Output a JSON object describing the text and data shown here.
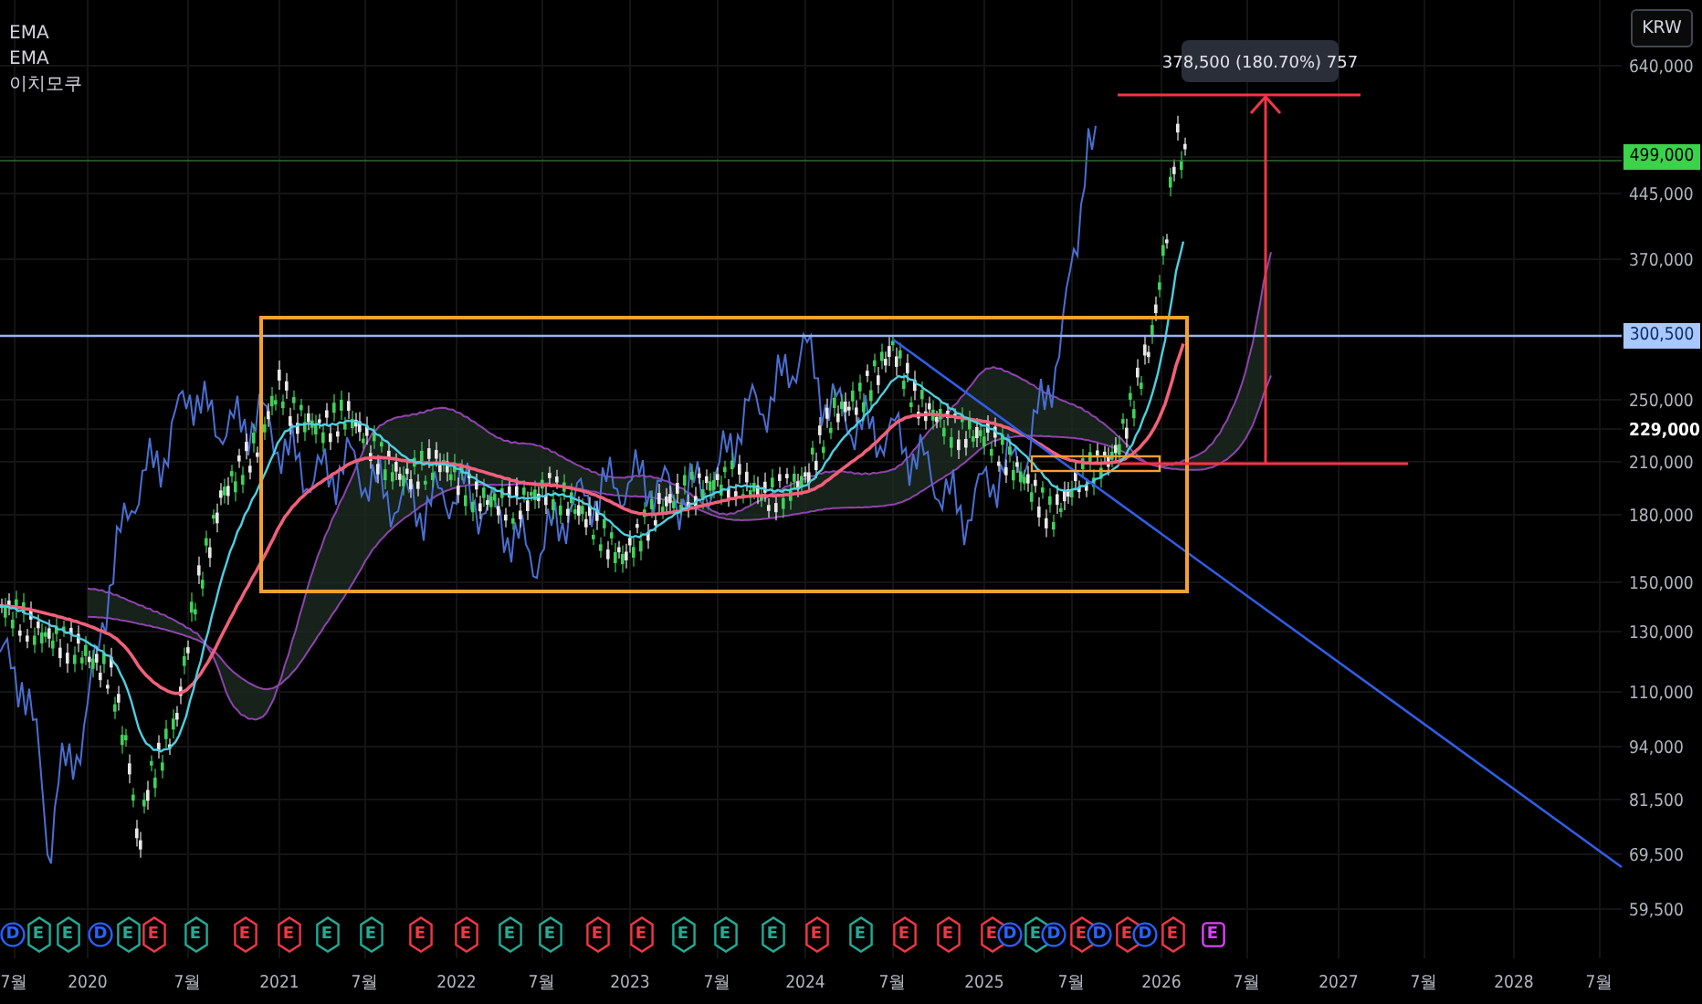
{
  "legend": [
    {
      "label": "EMA"
    },
    {
      "label": "EMA"
    },
    {
      "label": "이치모쿠"
    }
  ],
  "currency_button": {
    "label": "KRW"
  },
  "measure_label": "378,500 (180.70%) 757",
  "price_axis": [
    {
      "label": "640,000",
      "kind": "tick"
    },
    {
      "label": "499,000",
      "kind": "last_price"
    },
    {
      "label": "445,000",
      "kind": "tick"
    },
    {
      "label": "370,000",
      "kind": "tick"
    },
    {
      "label": "300,500",
      "kind": "line_price"
    },
    {
      "label": "250,000",
      "kind": "tick"
    },
    {
      "label": "229,000",
      "kind": "highlight"
    },
    {
      "label": "210,000",
      "kind": "tick"
    },
    {
      "label": "180,000",
      "kind": "tick"
    },
    {
      "label": "150,000",
      "kind": "tick"
    },
    {
      "label": "130,000",
      "kind": "tick"
    },
    {
      "label": "110,000",
      "kind": "tick"
    },
    {
      "label": "94,000",
      "kind": "tick"
    },
    {
      "label": "81,500",
      "kind": "tick"
    },
    {
      "label": "69,500",
      "kind": "tick"
    },
    {
      "label": "59,500",
      "kind": "tick"
    }
  ],
  "time_axis": [
    "7월",
    "2020",
    "7월",
    "2021",
    "7월",
    "2022",
    "7월",
    "2023",
    "7월",
    "2024",
    "7월",
    "2025",
    "7월",
    "2026",
    "7월",
    "2027",
    "7월",
    "2028",
    "7월"
  ],
  "events": [
    {
      "letter": "D",
      "kind": "dividend",
      "color": "#2962ff"
    },
    {
      "letter": "E",
      "kind": "earnings",
      "color": "#22ab94"
    },
    {
      "letter": "E",
      "kind": "earnings",
      "color": "#22ab94"
    },
    {
      "letter": "D",
      "kind": "dividend",
      "color": "#2962ff"
    },
    {
      "letter": "E",
      "kind": "earnings",
      "color": "#22ab94"
    },
    {
      "letter": "E",
      "kind": "earnings",
      "color": "#f23645"
    },
    {
      "letter": "E",
      "kind": "earnings",
      "color": "#22ab94"
    },
    {
      "letter": "E",
      "kind": "earnings",
      "color": "#f23645"
    },
    {
      "letter": "E",
      "kind": "earnings",
      "color": "#f23645"
    },
    {
      "letter": "E",
      "kind": "earnings",
      "color": "#22ab94"
    },
    {
      "letter": "E",
      "kind": "earnings",
      "color": "#22ab94"
    },
    {
      "letter": "E",
      "kind": "earnings",
      "color": "#f23645"
    },
    {
      "letter": "E",
      "kind": "earnings",
      "color": "#f23645"
    },
    {
      "letter": "E",
      "kind": "earnings",
      "color": "#22ab94"
    },
    {
      "letter": "E",
      "kind": "earnings",
      "color": "#22ab94"
    },
    {
      "letter": "E",
      "kind": "earnings",
      "color": "#f23645"
    },
    {
      "letter": "E",
      "kind": "earnings",
      "color": "#f23645"
    },
    {
      "letter": "E",
      "kind": "earnings",
      "color": "#22ab94"
    },
    {
      "letter": "E",
      "kind": "earnings",
      "color": "#22ab94"
    },
    {
      "letter": "E",
      "kind": "earnings",
      "color": "#22ab94"
    },
    {
      "letter": "E",
      "kind": "earnings",
      "color": "#f23645"
    },
    {
      "letter": "E",
      "kind": "earnings",
      "color": "#22ab94"
    },
    {
      "letter": "E",
      "kind": "earnings",
      "color": "#f23645"
    },
    {
      "letter": "E",
      "kind": "earnings",
      "color": "#f23645"
    },
    {
      "letter": "E",
      "kind": "earnings",
      "color": "#f23645"
    },
    {
      "letter": "D",
      "kind": "dividend",
      "color": "#2962ff"
    },
    {
      "letter": "E",
      "kind": "earnings",
      "color": "#22ab94"
    },
    {
      "letter": "D",
      "kind": "dividend",
      "color": "#2962ff"
    },
    {
      "letter": "E",
      "kind": "earnings",
      "color": "#f23645"
    },
    {
      "letter": "D",
      "kind": "dividend",
      "color": "#2962ff"
    },
    {
      "letter": "E",
      "kind": "earnings",
      "color": "#f23645"
    },
    {
      "letter": "D",
      "kind": "dividend",
      "color": "#2962ff"
    },
    {
      "letter": "E",
      "kind": "earnings",
      "color": "#f23645"
    },
    {
      "letter": "E",
      "kind": "upcoming",
      "color": "#e040fb"
    }
  ]
}
